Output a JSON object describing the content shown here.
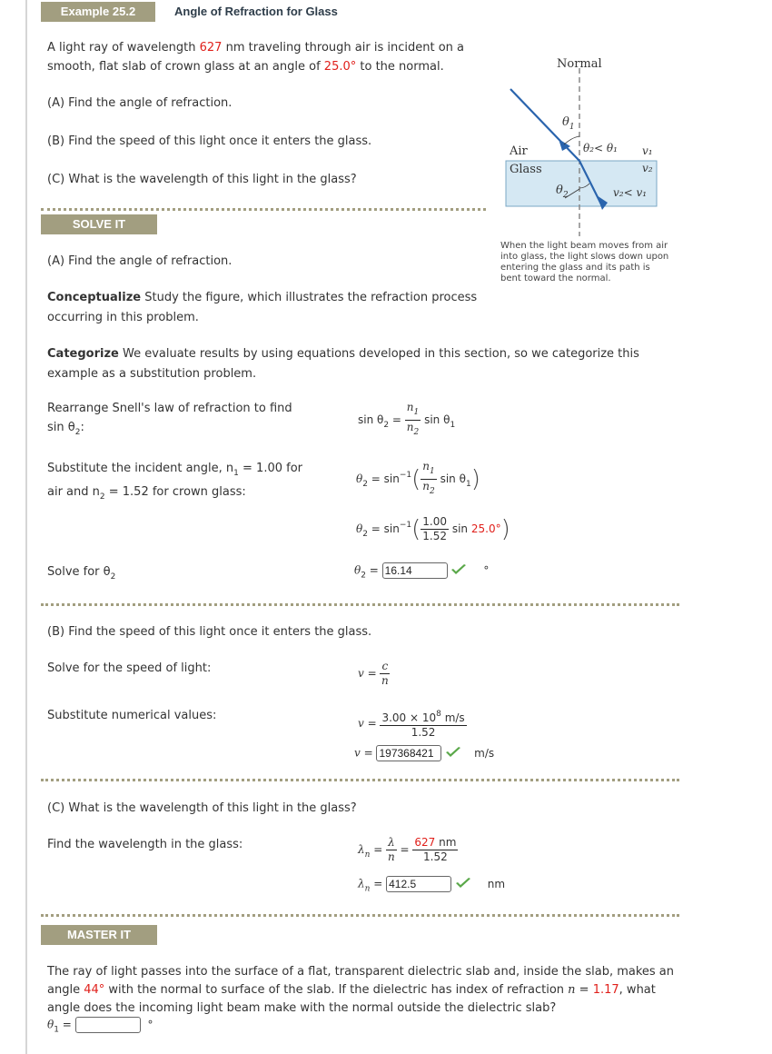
{
  "header": {
    "example_label": "Example 25.2",
    "title": "Angle of Refraction for Glass"
  },
  "problem": {
    "intro_part1": "A light ray of wavelength ",
    "wavelength": "627",
    "intro_part2": " nm traveling through air is incident on a",
    "intro_line2_part1": "smooth, flat slab of crown glass at an angle of ",
    "angle": "25.0°",
    "intro_line2_part2": " to the normal.",
    "part_a_label": "(A)",
    "part_a": " Find the angle of refraction.",
    "part_b_label": "(B)",
    "part_b": " Find the speed of this light once it enters the glass.",
    "part_c_label": "(C)",
    "part_c": " What is the wavelength of this light in the glass?"
  },
  "figure": {
    "normal_label": "Normal",
    "air_label": "Air",
    "glass_label": "Glass",
    "theta1": "θ",
    "theta2": "θ",
    "relation_angles": "θ₂< θ₁",
    "v1": "v₁",
    "v2": "v₂",
    "relation_speeds": "v₂< v₁",
    "caption": "When the light beam moves from air into glass, the light slows down upon entering the glass and its path is bent toward the normal.",
    "colors": {
      "ray": "#2a64ad",
      "glass": "#cfe4f0",
      "glass_border": "#7aa7c4"
    }
  },
  "solve_it": {
    "label": "SOLVE IT",
    "part_a_label": "(A)",
    "part_a": " Find the angle of refraction.",
    "conceptualize_label": "Conceptualize",
    "conceptualize": " Study the figure, which illustrates the refraction process",
    "conceptualize_line2": "occurring in this problem.",
    "categorize_label": "Categorize",
    "categorize": " We evaluate results by using equations developed in this section, so we categorize this",
    "categorize_line2": "example as a substitution problem.",
    "step1_line1": "Rearrange Snell's law of refraction to find",
    "step1_line2": "sin θ",
    "step1_sub": "2",
    "step1_end": ":",
    "step2_line1": "Substitute the incident angle, n",
    "step2_line1_b": " = 1.00 for",
    "step2_line2": "air and n",
    "step2_line2_b": " = 1.52 for crown glass:",
    "step3": "Solve for θ",
    "eq_sin": "sin θ",
    "eq_equals": " = ",
    "eq_sin_inv": "sin",
    "eq_inv_exp": "−1",
    "n1": "n",
    "n2": "n",
    "num_100": "1.00",
    "den_152": "1.52",
    "sin_angle": "sin ",
    "angle_value": "25.0°",
    "answer_theta2": "16.14",
    "unit_degree": "°"
  },
  "part_b": {
    "label": "(B)",
    "text": " Find the speed of this light once it enters the glass.",
    "step1": "Solve for the speed of light:",
    "step2": "Substitute numerical values:",
    "v": "v",
    "c": "c",
    "n": "n",
    "num": "3.00 × 10",
    "num_exp": "8",
    "num_unit": " m/s",
    "den": "1.52",
    "answer_v": "197368421",
    "unit": "m/s"
  },
  "part_c": {
    "label": "(C)",
    "text": " What is the wavelength of this light in the glass?",
    "step1": "Find the wavelength in the glass:",
    "lambda": "λ",
    "lambda_sub": "n",
    "n": "n",
    "num_value": "627",
    "num_unit": " nm",
    "den": "1.52",
    "answer_lambda": "412.5",
    "unit": "nm"
  },
  "master_it": {
    "label": "MASTER IT",
    "line1": "The ray of light passes into the surface of a flat, transparent dielectric slab and, inside the slab, makes an",
    "line2_a": "angle ",
    "angle": "44°",
    "line2_b": " with the normal to surface of the slab. If the dielectric has index of refraction ",
    "n_sym": "n",
    "line2_c": " = ",
    "n_value": "1.17",
    "line2_d": ", what",
    "line3": "angle does the incoming light beam make with the normal outside the dielectric slab?",
    "answer_label": "θ",
    "answer_sub": "1",
    "answer_value": "",
    "unit": "°"
  },
  "colors": {
    "accent_tag": "#a29e80",
    "highlight": "#e0201b",
    "check": "#5aa849"
  }
}
